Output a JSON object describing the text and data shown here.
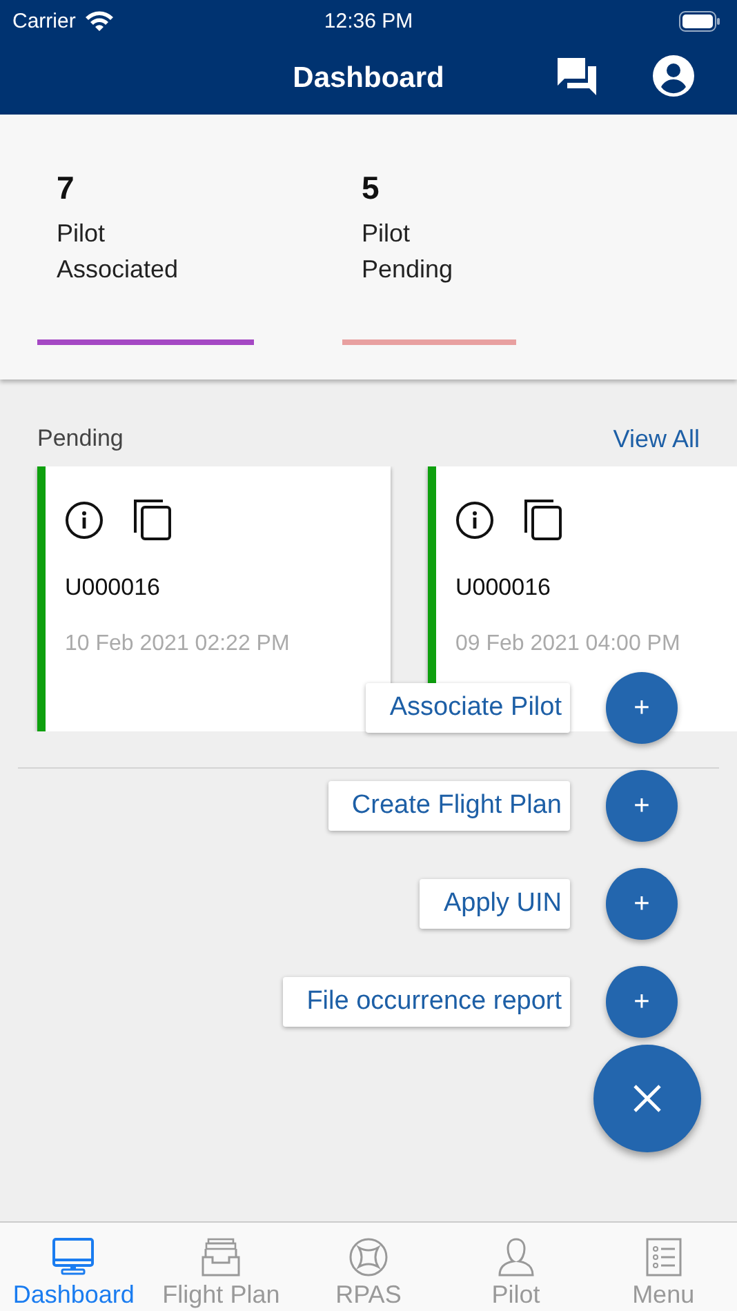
{
  "status_bar": {
    "carrier": "Carrier",
    "time": "12:36 PM"
  },
  "nav_bar": {
    "title": "Dashboard"
  },
  "stats": [
    {
      "count": "7",
      "line1": "Pilot",
      "line2": "Associated",
      "color": "#a548c4"
    },
    {
      "count": "5",
      "line1": "Pilot",
      "line2": "Pending",
      "color": "#e8a0a0"
    }
  ],
  "pending": {
    "title": "Pending",
    "view_all": "View All",
    "cards": [
      {
        "id": "U000016",
        "date": "10 Feb 2021 02:22 PM",
        "color": "#0ea00e"
      },
      {
        "id": "U000016",
        "date": "09 Feb 2021 04:00 PM",
        "color": "#0ea00e"
      }
    ]
  },
  "fab_menu": {
    "expanded": true,
    "actions": [
      {
        "label": "Associate Pilot",
        "icon": "+"
      },
      {
        "label": "Create Flight Plan",
        "icon": "+"
      },
      {
        "label": "Apply UIN",
        "icon": "+"
      },
      {
        "label": "File occurrence report",
        "icon": "+"
      }
    ]
  },
  "tab_bar": [
    {
      "label": "Dashboard",
      "selected": true
    },
    {
      "label": "Flight Plan",
      "selected": false
    },
    {
      "label": "RPAS",
      "selected": false
    },
    {
      "label": "Pilot",
      "selected": false
    },
    {
      "label": "Menu",
      "selected": false
    }
  ]
}
